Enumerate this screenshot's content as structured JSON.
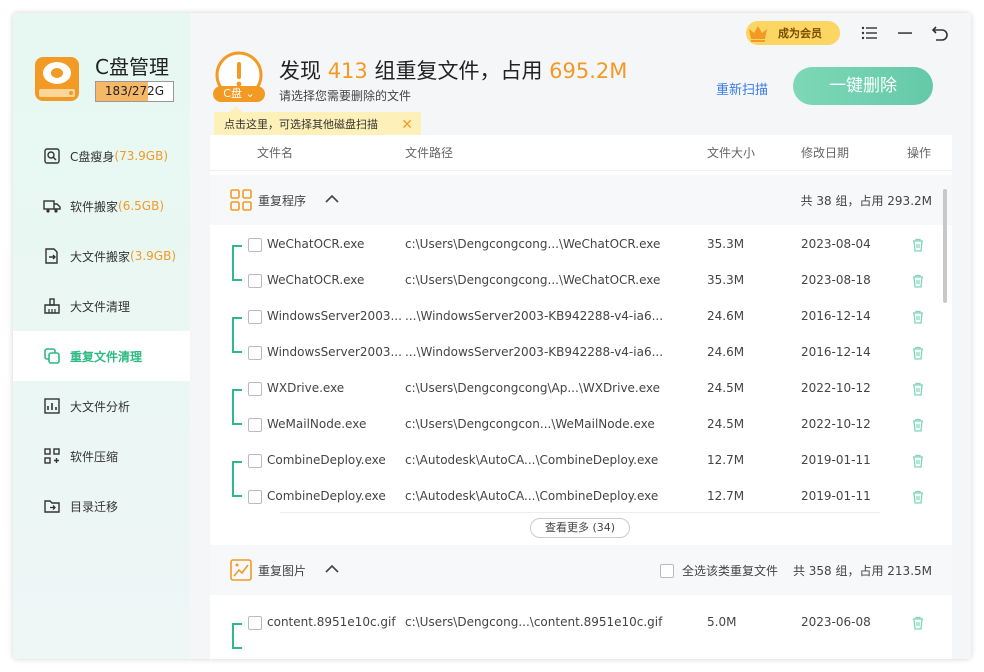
{
  "app": {
    "title": "C盘管理",
    "disk_usage_label": "183/272G",
    "disk_usage_fraction": 0.67
  },
  "sidebar": {
    "items": [
      {
        "label": "C盘瘦身",
        "size": "(73.9GB)",
        "icon": "disk-search-icon"
      },
      {
        "label": "软件搬家",
        "size": "(6.5GB)",
        "icon": "truck-icon"
      },
      {
        "label": "大文件搬家",
        "size": "(3.9GB)",
        "icon": "file-move-icon"
      },
      {
        "label": "大文件清理",
        "size": "",
        "icon": "broom-icon"
      },
      {
        "label": "重复文件清理",
        "size": "",
        "icon": "duplicate-icon",
        "active": true
      },
      {
        "label": "大文件分析",
        "size": "",
        "icon": "chart-icon"
      },
      {
        "label": "软件压缩",
        "size": "",
        "icon": "grid-compress-icon"
      },
      {
        "label": "目录迁移",
        "size": "",
        "icon": "folder-move-icon"
      }
    ]
  },
  "header": {
    "disk_pill": "C盘",
    "headline_prefix": "发现",
    "group_count": "413",
    "headline_mid": "组重复文件，占用",
    "total_size": "695.2M",
    "subline": "请选择您需要删除的文件",
    "tip": "点击这里，可选择其他磁盘扫描",
    "rescan": "重新扫描",
    "delete_all": "一键删除",
    "vip": "成为会员"
  },
  "colors": {
    "accent": "#2fba85",
    "orange": "#f29a24",
    "link": "#3b7be6"
  },
  "table": {
    "columns": [
      "文件名",
      "文件路径",
      "文件大小",
      "修改日期",
      "操作"
    ],
    "groups": [
      {
        "name": "重复程序",
        "summary": "共 38 组，占用 293.2M",
        "rows": [
          [
            "WeChatOCR.exe",
            "c:\\Users\\Dengcongcong...\\WeChatOCR.exe",
            "35.3M",
            "2023-08-04"
          ],
          [
            "WeChatOCR.exe",
            "c:\\Users\\Dengcongcong...\\WeChatOCR.exe",
            "35.3M",
            "2023-08-18"
          ],
          [
            "WindowsServer2003...",
            "...\\WindowsServer2003-KB942288-v4-ia6...",
            "24.6M",
            "2016-12-14"
          ],
          [
            "WindowsServer2003...",
            "...\\WindowsServer2003-KB942288-v4-ia6...",
            "24.6M",
            "2016-12-14"
          ],
          [
            "WXDrive.exe",
            "c:\\Users\\Dengcongcong\\Ap...\\WXDrive.exe",
            "24.5M",
            "2022-10-12"
          ],
          [
            "WeMailNode.exe",
            "c:\\Users\\Dengcongcon...\\WeMailNode.exe",
            "24.5M",
            "2022-10-12"
          ],
          [
            "CombineDeploy.exe",
            "c:\\Autodesk\\AutoCA...\\CombineDeploy.exe",
            "12.7M",
            "2019-01-11"
          ],
          [
            "CombineDeploy.exe",
            "c:\\Autodesk\\AutoCA...\\CombineDeploy.exe",
            "12.7M",
            "2019-01-11"
          ]
        ],
        "more": "查看更多 (34)"
      },
      {
        "name": "重复图片",
        "select_all": "全选该类重复文件",
        "summary": "共 358 组，占用 213.5M",
        "rows": [
          [
            "content.8951e10c.gif",
            "c:\\Users\\Dengcong...\\content.8951e10c.gif",
            "5.0M",
            "2023-06-08"
          ]
        ]
      }
    ]
  }
}
